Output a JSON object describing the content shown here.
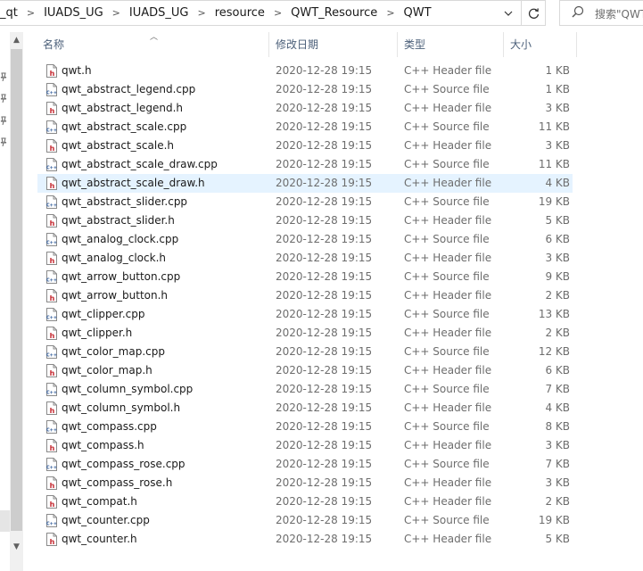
{
  "address_bar": {
    "crumbs": [
      "_qt",
      "IUADS_UG",
      "IUADS_UG",
      "resource",
      "QWT_Resource",
      "QWT"
    ],
    "separator": ">"
  },
  "search": {
    "placeholder": "搜索\"QWT\""
  },
  "columns": {
    "name": "名称",
    "date": "修改日期",
    "type": "类型",
    "size": "大小"
  },
  "icons": {
    "header_file": "h-file-icon",
    "source_file": "cpp-file-icon",
    "search": "search-icon",
    "refresh": "refresh-icon",
    "dropdown": "chevron-down-icon"
  },
  "colors": {
    "header_icon": "#c4262e",
    "source_icon": "#2b5797",
    "selected_row": "#e5f3ff"
  },
  "files": [
    {
      "name": "qwt.h",
      "date": "2020-12-28 19:15",
      "type": "C++ Header file",
      "size": "1 KB",
      "kind": "h"
    },
    {
      "name": "qwt_abstract_legend.cpp",
      "date": "2020-12-28 19:15",
      "type": "C++ Source file",
      "size": "1 KB",
      "kind": "cpp"
    },
    {
      "name": "qwt_abstract_legend.h",
      "date": "2020-12-28 19:15",
      "type": "C++ Header file",
      "size": "3 KB",
      "kind": "h"
    },
    {
      "name": "qwt_abstract_scale.cpp",
      "date": "2020-12-28 19:15",
      "type": "C++ Source file",
      "size": "11 KB",
      "kind": "cpp"
    },
    {
      "name": "qwt_abstract_scale.h",
      "date": "2020-12-28 19:15",
      "type": "C++ Header file",
      "size": "3 KB",
      "kind": "h"
    },
    {
      "name": "qwt_abstract_scale_draw.cpp",
      "date": "2020-12-28 19:15",
      "type": "C++ Source file",
      "size": "11 KB",
      "kind": "cpp"
    },
    {
      "name": "qwt_abstract_scale_draw.h",
      "date": "2020-12-28 19:15",
      "type": "C++ Header file",
      "size": "4 KB",
      "kind": "h",
      "selected": true
    },
    {
      "name": "qwt_abstract_slider.cpp",
      "date": "2020-12-28 19:15",
      "type": "C++ Source file",
      "size": "19 KB",
      "kind": "cpp"
    },
    {
      "name": "qwt_abstract_slider.h",
      "date": "2020-12-28 19:15",
      "type": "C++ Header file",
      "size": "5 KB",
      "kind": "h"
    },
    {
      "name": "qwt_analog_clock.cpp",
      "date": "2020-12-28 19:15",
      "type": "C++ Source file",
      "size": "6 KB",
      "kind": "cpp"
    },
    {
      "name": "qwt_analog_clock.h",
      "date": "2020-12-28 19:15",
      "type": "C++ Header file",
      "size": "3 KB",
      "kind": "h"
    },
    {
      "name": "qwt_arrow_button.cpp",
      "date": "2020-12-28 19:15",
      "type": "C++ Source file",
      "size": "9 KB",
      "kind": "cpp"
    },
    {
      "name": "qwt_arrow_button.h",
      "date": "2020-12-28 19:15",
      "type": "C++ Header file",
      "size": "2 KB",
      "kind": "h"
    },
    {
      "name": "qwt_clipper.cpp",
      "date": "2020-12-28 19:15",
      "type": "C++ Source file",
      "size": "13 KB",
      "kind": "cpp"
    },
    {
      "name": "qwt_clipper.h",
      "date": "2020-12-28 19:15",
      "type": "C++ Header file",
      "size": "2 KB",
      "kind": "h"
    },
    {
      "name": "qwt_color_map.cpp",
      "date": "2020-12-28 19:15",
      "type": "C++ Source file",
      "size": "12 KB",
      "kind": "cpp"
    },
    {
      "name": "qwt_color_map.h",
      "date": "2020-12-28 19:15",
      "type": "C++ Header file",
      "size": "6 KB",
      "kind": "h"
    },
    {
      "name": "qwt_column_symbol.cpp",
      "date": "2020-12-28 19:15",
      "type": "C++ Source file",
      "size": "7 KB",
      "kind": "cpp"
    },
    {
      "name": "qwt_column_symbol.h",
      "date": "2020-12-28 19:15",
      "type": "C++ Header file",
      "size": "4 KB",
      "kind": "h"
    },
    {
      "name": "qwt_compass.cpp",
      "date": "2020-12-28 19:15",
      "type": "C++ Source file",
      "size": "8 KB",
      "kind": "cpp"
    },
    {
      "name": "qwt_compass.h",
      "date": "2020-12-28 19:15",
      "type": "C++ Header file",
      "size": "3 KB",
      "kind": "h"
    },
    {
      "name": "qwt_compass_rose.cpp",
      "date": "2020-12-28 19:15",
      "type": "C++ Source file",
      "size": "7 KB",
      "kind": "cpp"
    },
    {
      "name": "qwt_compass_rose.h",
      "date": "2020-12-28 19:15",
      "type": "C++ Header file",
      "size": "3 KB",
      "kind": "h"
    },
    {
      "name": "qwt_compat.h",
      "date": "2020-12-28 19:15",
      "type": "C++ Header file",
      "size": "2 KB",
      "kind": "h"
    },
    {
      "name": "qwt_counter.cpp",
      "date": "2020-12-28 19:15",
      "type": "C++ Source file",
      "size": "19 KB",
      "kind": "cpp"
    },
    {
      "name": "qwt_counter.h",
      "date": "2020-12-28 19:15",
      "type": "C++ Header file",
      "size": "5 KB",
      "kind": "h"
    }
  ]
}
